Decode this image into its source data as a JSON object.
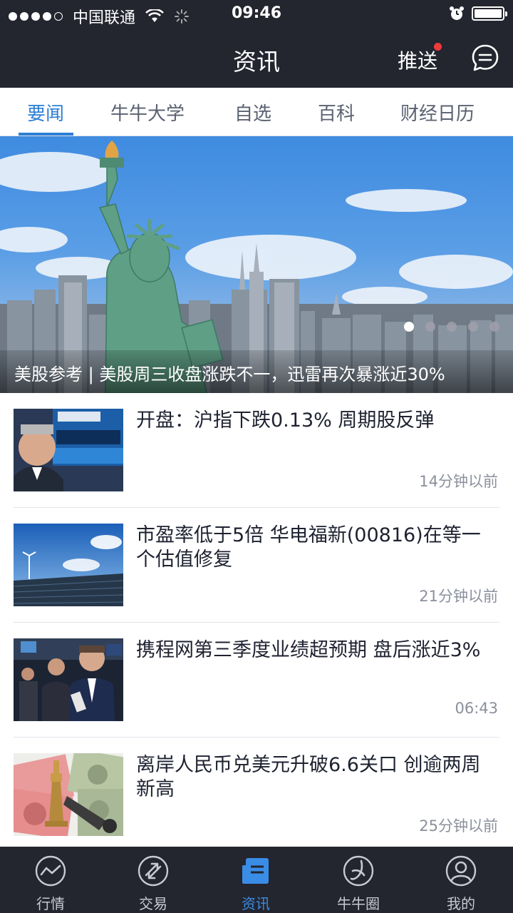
{
  "status_bar": {
    "carrier": "中国联通",
    "time": "09:46"
  },
  "header": {
    "title": "资讯",
    "push_label": "推送"
  },
  "tabs": [
    {
      "label": "要闻",
      "active": true
    },
    {
      "label": "牛牛大学",
      "active": false
    },
    {
      "label": "自选",
      "active": false
    },
    {
      "label": "百科",
      "active": false
    },
    {
      "label": "财经日历",
      "active": false
    }
  ],
  "banner": {
    "caption": "美股参考 | 美股周三收盘涨跌不一，迅雷再次暴涨近30%",
    "page_count": 5,
    "current_page": 1
  },
  "news": [
    {
      "title": "开盘：沪指下跌0.13% 周期股反弹",
      "time": "14分钟以前",
      "thumb_icon": "trader-photo-thumbnail"
    },
    {
      "title": "市盈率低于5倍 华电福新(00816)在等一个估值修复",
      "time": "21分钟以前",
      "thumb_icon": "solar-farm-thumbnail"
    },
    {
      "title": "携程网第三季度业绩超预期 盘后涨近3%",
      "time": "06:43",
      "thumb_icon": "trading-floor-thumbnail"
    },
    {
      "title": "离岸人民币兑美元升破6.6关口 创逾两周新高",
      "time": "25分钟以前",
      "thumb_icon": "currency-chess-thumbnail"
    }
  ],
  "bottom_tabs": [
    {
      "label": "行情",
      "icon": "market-chart-icon",
      "active": false
    },
    {
      "label": "交易",
      "icon": "trade-arrows-icon",
      "active": false
    },
    {
      "label": "资讯",
      "icon": "news-icon",
      "active": true
    },
    {
      "label": "牛牛圈",
      "icon": "community-circle-icon",
      "active": false
    },
    {
      "label": "我的",
      "icon": "profile-icon",
      "active": false
    }
  ],
  "colors": {
    "bar_bg": "#23252f",
    "accent": "#2d7fd6",
    "tabbar_active": "#3a8de6",
    "badge_red": "#f03a3a"
  }
}
